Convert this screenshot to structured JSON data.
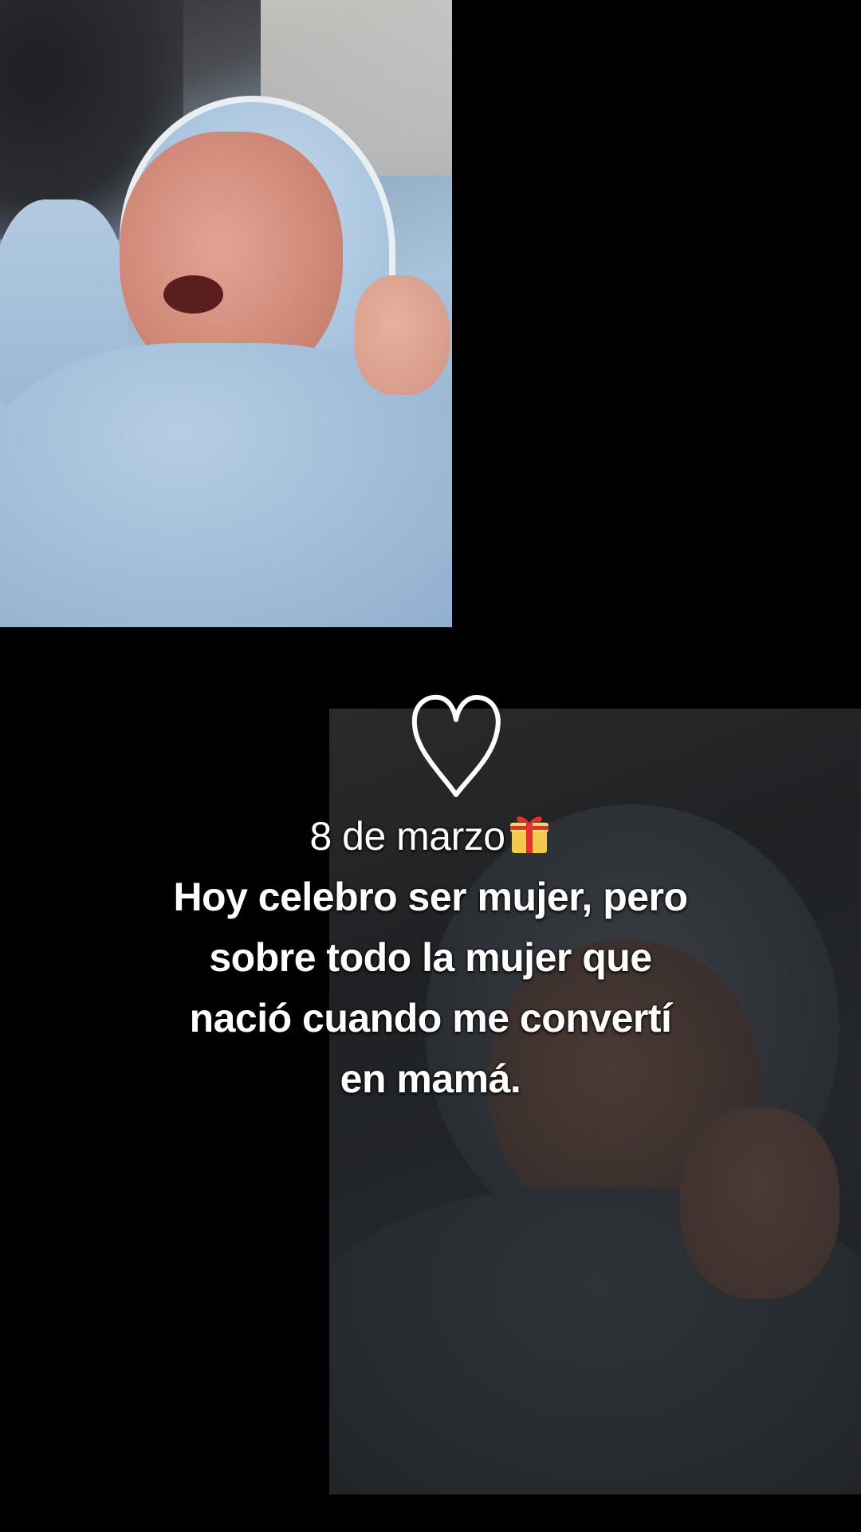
{
  "photos": {
    "top": {
      "subject": "newborn-baby-blue-hat"
    },
    "bottom": {
      "subject": "newborn-baby-dimmed"
    }
  },
  "overlay": {
    "heart_icon": "heart-outline-icon",
    "gift_icon": "wrapped-gift-icon",
    "line1": "8 de marzo",
    "line2": "Hoy celebro ser mujer, pero",
    "line3": "sobre todo la mujer que",
    "line4": "nació cuando me convertí",
    "line5": "en mamá."
  },
  "colors": {
    "background": "#000000",
    "text": "#ffffff",
    "blanket": "#a9c3dc"
  }
}
